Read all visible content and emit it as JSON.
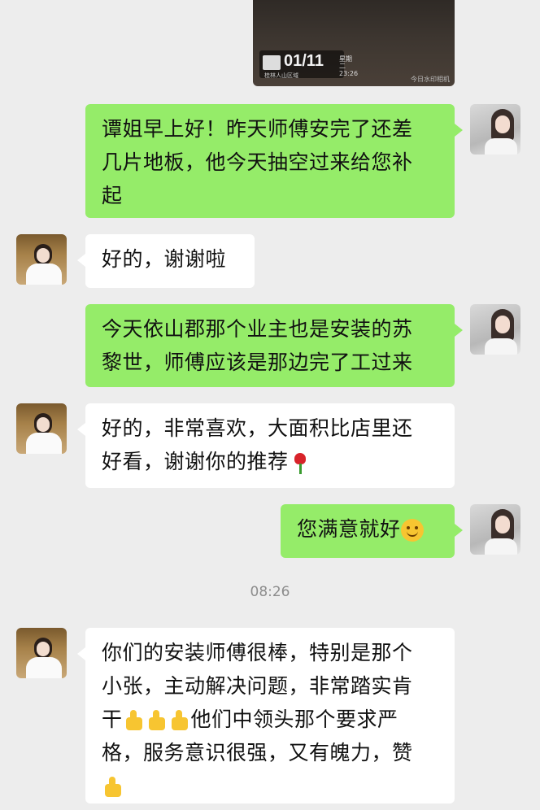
{
  "photo": {
    "date": "01/11",
    "subtext": "星期二 23:26",
    "location": "桂林人山区域",
    "brand": "今日水印相机"
  },
  "timestamp": "08:26",
  "messages": [
    {
      "sender": "me",
      "lines": [
        "谭姐早上好！昨天师傅安完了还差",
        "几片地板，他今天抽空过来给您补",
        "起"
      ]
    },
    {
      "sender": "other",
      "lines": [
        "好的，谢谢啦"
      ]
    },
    {
      "sender": "me",
      "lines": [
        "今天依山郡那个业主也是安装的苏",
        "黎世，师傅应该是那边完了工过来"
      ]
    },
    {
      "sender": "other",
      "lines": [
        "好的，非常喜欢，大面积比店里还",
        "好看，谢谢你的推荐"
      ],
      "emoji": "rose-icon"
    },
    {
      "sender": "me",
      "lines": [
        "您满意就好"
      ],
      "emoji": "smile-icon"
    },
    {
      "sender": "other",
      "lines": [
        "你们的安装师傅很棒，特别是那个",
        "小张，主动解决问题，非常踏实肯",
        "干",
        "他们中领头那个要求严",
        "格，服务意识很强，又有魄力，赞"
      ],
      "emoji": "thumbs-up-icon"
    }
  ]
}
